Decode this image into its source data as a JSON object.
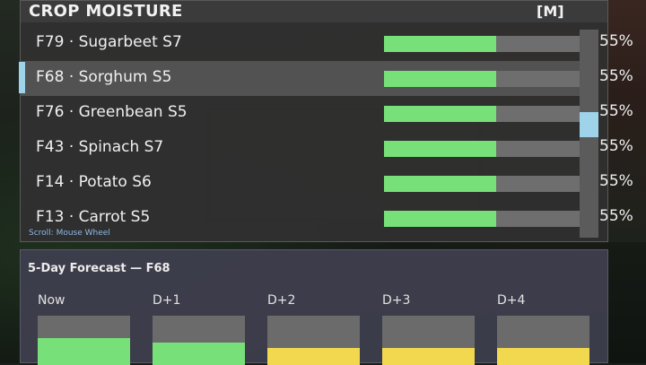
{
  "panel": {
    "title": "CROP MOISTURE",
    "key_hint": "[M]",
    "scroll_hint": "Scroll: Mouse Wheel",
    "scroll_position": 0.45,
    "colors": {
      "fill": "#77e078",
      "track": "#6e6e6e",
      "accent": "#9fd3ea"
    }
  },
  "rows": [
    {
      "label": "F79 · Sugarbeet S7",
      "moisture": 0.55,
      "pct": "55%",
      "selected": false
    },
    {
      "label": "F68 · Sorghum S5",
      "moisture": 0.55,
      "pct": "55%",
      "selected": true
    },
    {
      "label": "F76 · Greenbean S5",
      "moisture": 0.55,
      "pct": "55%",
      "selected": false
    },
    {
      "label": "F43 · Spinach S7",
      "moisture": 0.55,
      "pct": "55%",
      "selected": false
    },
    {
      "label": "F14 · Potato S6",
      "moisture": 0.55,
      "pct": "55%",
      "selected": false
    },
    {
      "label": "F13 · Carrot S5",
      "moisture": 0.55,
      "pct": "55%",
      "selected": false
    }
  ],
  "forecast": {
    "title": "5-Day Forecast — F68",
    "days": [
      {
        "label": "Now",
        "level": 0.55,
        "color": "#77e078"
      },
      {
        "label": "D+1",
        "level": 0.45,
        "color": "#77e078"
      },
      {
        "label": "D+2",
        "level": 0.35,
        "color": "#f2d84f"
      },
      {
        "label": "D+3",
        "level": 0.35,
        "color": "#f2d84f"
      },
      {
        "label": "D+4",
        "level": 0.35,
        "color": "#f2d84f"
      }
    ]
  }
}
